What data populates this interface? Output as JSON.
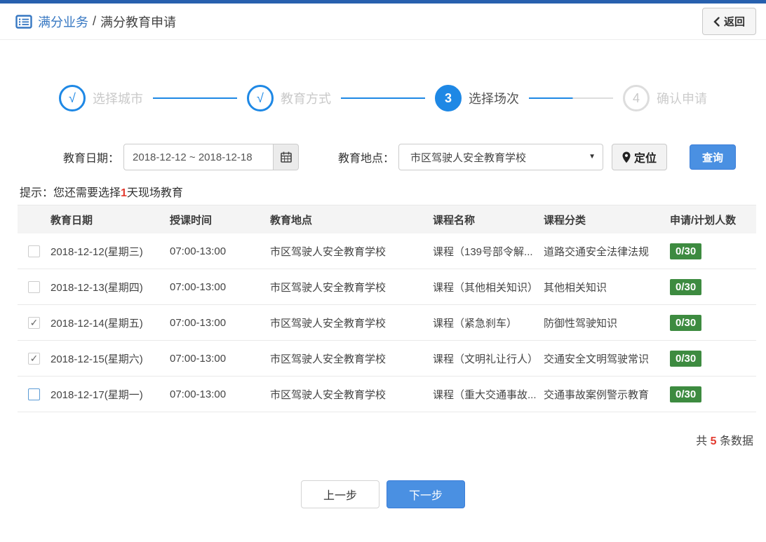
{
  "header": {
    "breadcrumb_primary": "满分业务",
    "breadcrumb_separator": "/",
    "breadcrumb_secondary": "满分教育申请",
    "back_label": "返回"
  },
  "stepper": {
    "steps": [
      {
        "marker": "√",
        "label": "选择城市",
        "state": "done"
      },
      {
        "marker": "√",
        "label": "教育方式",
        "state": "done"
      },
      {
        "marker": "3",
        "label": "选择场次",
        "state": "current"
      },
      {
        "marker": "4",
        "label": "确认申请",
        "state": "future"
      }
    ]
  },
  "filters": {
    "date_label": "教育日期：",
    "date_value": "2018-12-12 ~ 2018-12-18",
    "location_label": "教育地点：",
    "location_value": "市区驾驶人安全教育学校",
    "dropdown_arrow": "▼",
    "locate_label": "定位",
    "search_label": "查询"
  },
  "hint": {
    "prefix": "提示：您还需要选择",
    "highlight": "1",
    "suffix": "天现场教育"
  },
  "table": {
    "columns": [
      "教育日期",
      "授课时间",
      "教育地点",
      "课程名称",
      "课程分类",
      "申请/计划人数"
    ],
    "check_glyph": "✓",
    "rows": [
      {
        "checked": false,
        "highlight": false,
        "date": "2018-12-12(星期三)",
        "time": "07:00-13:00",
        "location": "市区驾驶人安全教育学校",
        "course": "课程（139号部令解...",
        "category": "道路交通安全法律法规",
        "count": "0/30"
      },
      {
        "checked": false,
        "highlight": false,
        "date": "2018-12-13(星期四)",
        "time": "07:00-13:00",
        "location": "市区驾驶人安全教育学校",
        "course": "课程（其他相关知识）",
        "category": "其他相关知识",
        "count": "0/30"
      },
      {
        "checked": true,
        "highlight": false,
        "date": "2018-12-14(星期五)",
        "time": "07:00-13:00",
        "location": "市区驾驶人安全教育学校",
        "course": "课程（紧急刹车）",
        "category": "防御性驾驶知识",
        "count": "0/30"
      },
      {
        "checked": true,
        "highlight": false,
        "date": "2018-12-15(星期六)",
        "time": "07:00-13:00",
        "location": "市区驾驶人安全教育学校",
        "course": "课程（文明礼让行人）",
        "category": "交通安全文明驾驶常识",
        "count": "0/30"
      },
      {
        "checked": false,
        "highlight": true,
        "date": "2018-12-17(星期一)",
        "time": "07:00-13:00",
        "location": "市区驾驶人安全教育学校",
        "course": "课程（重大交通事故...",
        "category": "交通事故案例警示教育",
        "count": "0/30"
      }
    ]
  },
  "footer": {
    "total_prefix": "共",
    "total_count": "5",
    "total_suffix": "条数据"
  },
  "actions": {
    "prev_label": "上一步",
    "next_label": "下一步"
  },
  "colors": {
    "topbar_blue": "#2760ae",
    "brand_blue": "#3677c2",
    "stepper_blue": "#1e88e5",
    "button_blue": "#4a90e2",
    "badge_green": "#3d8b40",
    "alert_red": "#e23b30"
  }
}
